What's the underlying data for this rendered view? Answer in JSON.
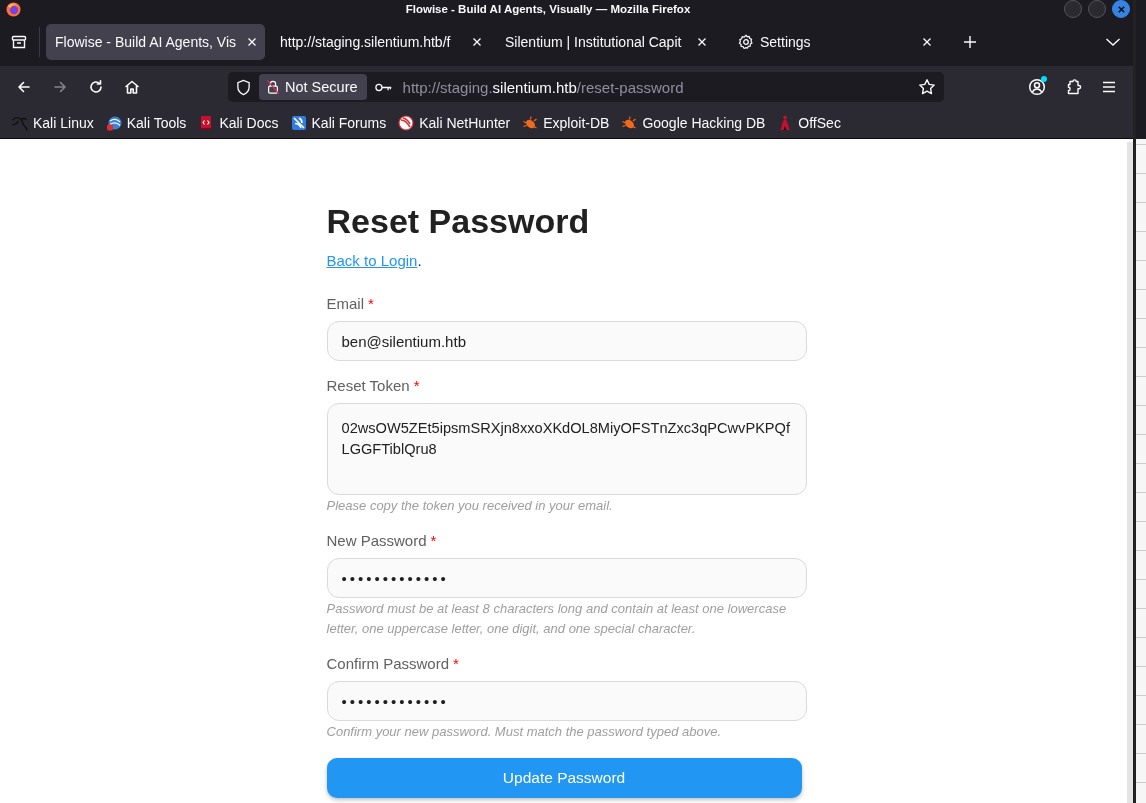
{
  "window": {
    "title": "Flowise - Build AI Agents, Visually — Mozilla Firefox"
  },
  "tabs": [
    {
      "kind": "page",
      "title": "Flowise - Build AI Agents, Vis",
      "selected": true
    },
    {
      "kind": "page",
      "title": "http://staging.silentium.htb/f",
      "selected": false
    },
    {
      "kind": "page",
      "title": "Silentium | Institutional Capit",
      "selected": false
    },
    {
      "kind": "settings",
      "title": "Settings",
      "selected": false
    }
  ],
  "navigation": [
    {
      "kind": "back",
      "disabled": false
    },
    {
      "kind": "forward",
      "disabled": true
    },
    {
      "kind": "reload",
      "disabled": false
    },
    {
      "kind": "home",
      "disabled": false
    }
  ],
  "address_bar": {
    "security_label": "Not Secure",
    "url_prefix": "http://staging.",
    "url_domain": "silentium.htb",
    "url_path": "/reset-password"
  },
  "toolbar": {
    "account_badge": true
  },
  "bookmarks": [
    {
      "kind": "kali-linux",
      "label": "Kali Linux"
    },
    {
      "kind": "kali-tools",
      "label": "Kali Tools"
    },
    {
      "kind": "kali-docs",
      "label": "Kali Docs"
    },
    {
      "kind": "kali-forums",
      "label": "Kali Forums"
    },
    {
      "kind": "nethunter",
      "label": "Kali NetHunter"
    },
    {
      "kind": "exploit-db",
      "label": "Exploit-DB"
    },
    {
      "kind": "exploit-db",
      "label": "Google Hacking DB"
    },
    {
      "kind": "offsec",
      "label": "OffSec"
    }
  ],
  "page": {
    "heading": "Reset Password",
    "back_link": "Back to Login",
    "back_link_suffix": ".",
    "fields": [
      {
        "kind": "text",
        "label": "Email",
        "required_mark": "*",
        "value": "ben@silentium.htb"
      },
      {
        "kind": "textarea",
        "label": "Reset Token",
        "required_mark": "*",
        "value": "02wsOW5ZEt5ipsmSRXjn8xxoXKdOL8MiyOFSTnZxc3qPCwvPKPQfLGGFTiblQru8",
        "hint": "Please copy the token you received in your email."
      },
      {
        "kind": "password",
        "label": "New Password",
        "required_mark": "*",
        "value": "•••••••••••••",
        "hint": "Password must be at least 8 characters long and contain at least one lowercase letter, one uppercase letter, one digit, and one special character."
      },
      {
        "kind": "password",
        "label": "Confirm Password",
        "required_mark": "*",
        "value": "•••••••••••••",
        "hint": "Confirm your new password. Must match the password typed above."
      }
    ],
    "submit": "Update Password"
  }
}
